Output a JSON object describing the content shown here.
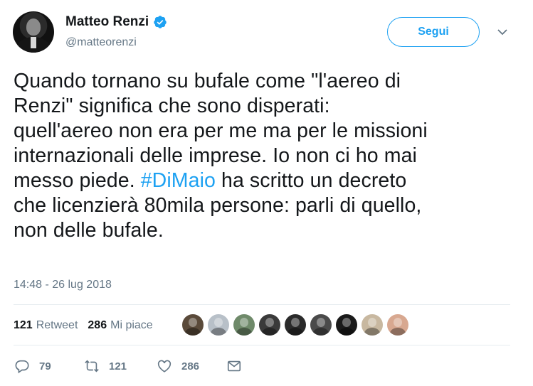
{
  "author": {
    "display_name": "Matteo Renzi",
    "handle": "@matteorenzi",
    "verified_icon": "verified-badge-icon"
  },
  "follow_button": {
    "label": "Segui"
  },
  "tweet": {
    "lines": [
      "Quando tornano su bufale come \"l'aereo di",
      "Renzi\" significa che sono disperati:",
      "quell'aereo non era per me ma per le missioni",
      "internazionali delle imprese. Io non ci ho mai"
    ],
    "line5_before": "messo piede. ",
    "hashtag": "#DiMaio",
    "line5_after": " ha scritto un decreto",
    "line6": "che licenzierà 80mila persone: parli di quello,",
    "line7": "non delle bufale.",
    "timestamp": "14:48 - 26 lug 2018"
  },
  "stats": {
    "retweets_count": "121",
    "retweets_label": "Retweet",
    "likes_count": "286",
    "likes_label": "Mi piace"
  },
  "likers": [
    "#5a4a3a",
    "#b8c0c8",
    "#6f8a6a",
    "#3a3a3a",
    "#2a2a2a",
    "#4a4a4a",
    "#1a1a1a",
    "#c8b8a0",
    "#d8a890"
  ],
  "actions": {
    "replies": "79",
    "retweets": "121",
    "likes": "286"
  },
  "colors": {
    "accent": "#1da1f2",
    "muted": "#657786",
    "text": "#14171a"
  }
}
